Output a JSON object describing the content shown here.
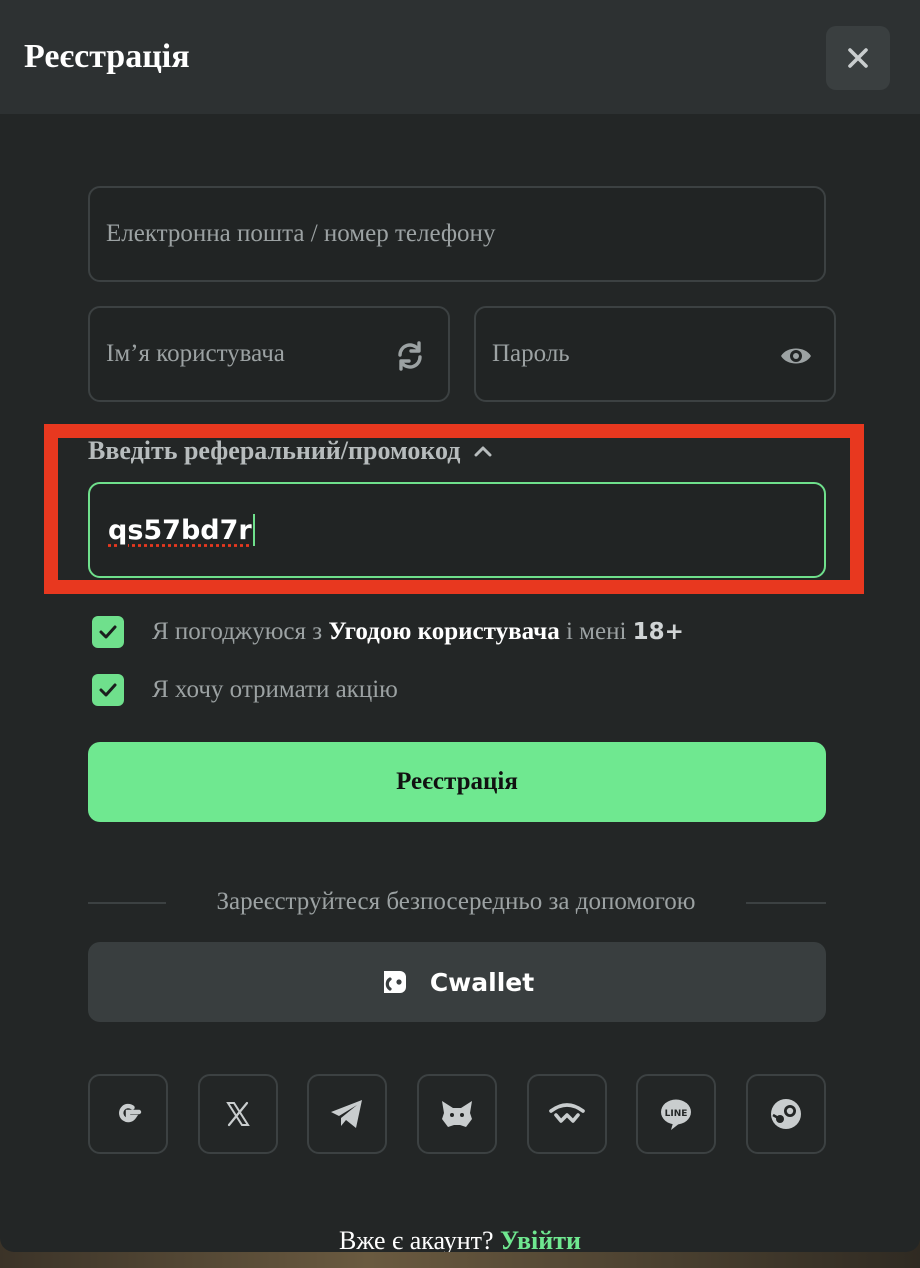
{
  "modal": {
    "title": "Реєстрація",
    "close_icon": "close-icon"
  },
  "form": {
    "email_placeholder": "Електронна пошта / номер телефону",
    "username_placeholder": "Ім’я користувача",
    "username_icon": "refresh-icon",
    "password_placeholder": "Пароль",
    "password_icon": "eye-icon",
    "promo_label": "Введіть реферальний/промокод",
    "promo_toggle_icon": "chevron-up-icon",
    "promo_value": "qs57bd7r",
    "agree_prefix": "Я погоджуюся з",
    "agree_link": "Угодою користувача",
    "agree_middle": "і мені",
    "agree_age": "18+",
    "agree_checked": true,
    "promo_optin_label": "Я хочу отримати акцію",
    "promo_optin_checked": true,
    "register_button": "Реєстрація"
  },
  "social": {
    "divider_text": "Зареєструйтеся безпосередньо за допомогою",
    "cwallet_label": "Cwallet",
    "cwallet_icon": "cwallet-icon",
    "providers": [
      "google-icon",
      "x-icon",
      "telegram-icon",
      "metamask-icon",
      "walletconnect-icon",
      "line-icon",
      "steam-icon"
    ]
  },
  "footer": {
    "prompt": "Вже є акаунт?",
    "login_link": "Увійти"
  },
  "colors": {
    "accent": "#6fe890",
    "highlight": "#e8381f",
    "modal_bg": "#232626",
    "header_bg": "#2d3132"
  }
}
